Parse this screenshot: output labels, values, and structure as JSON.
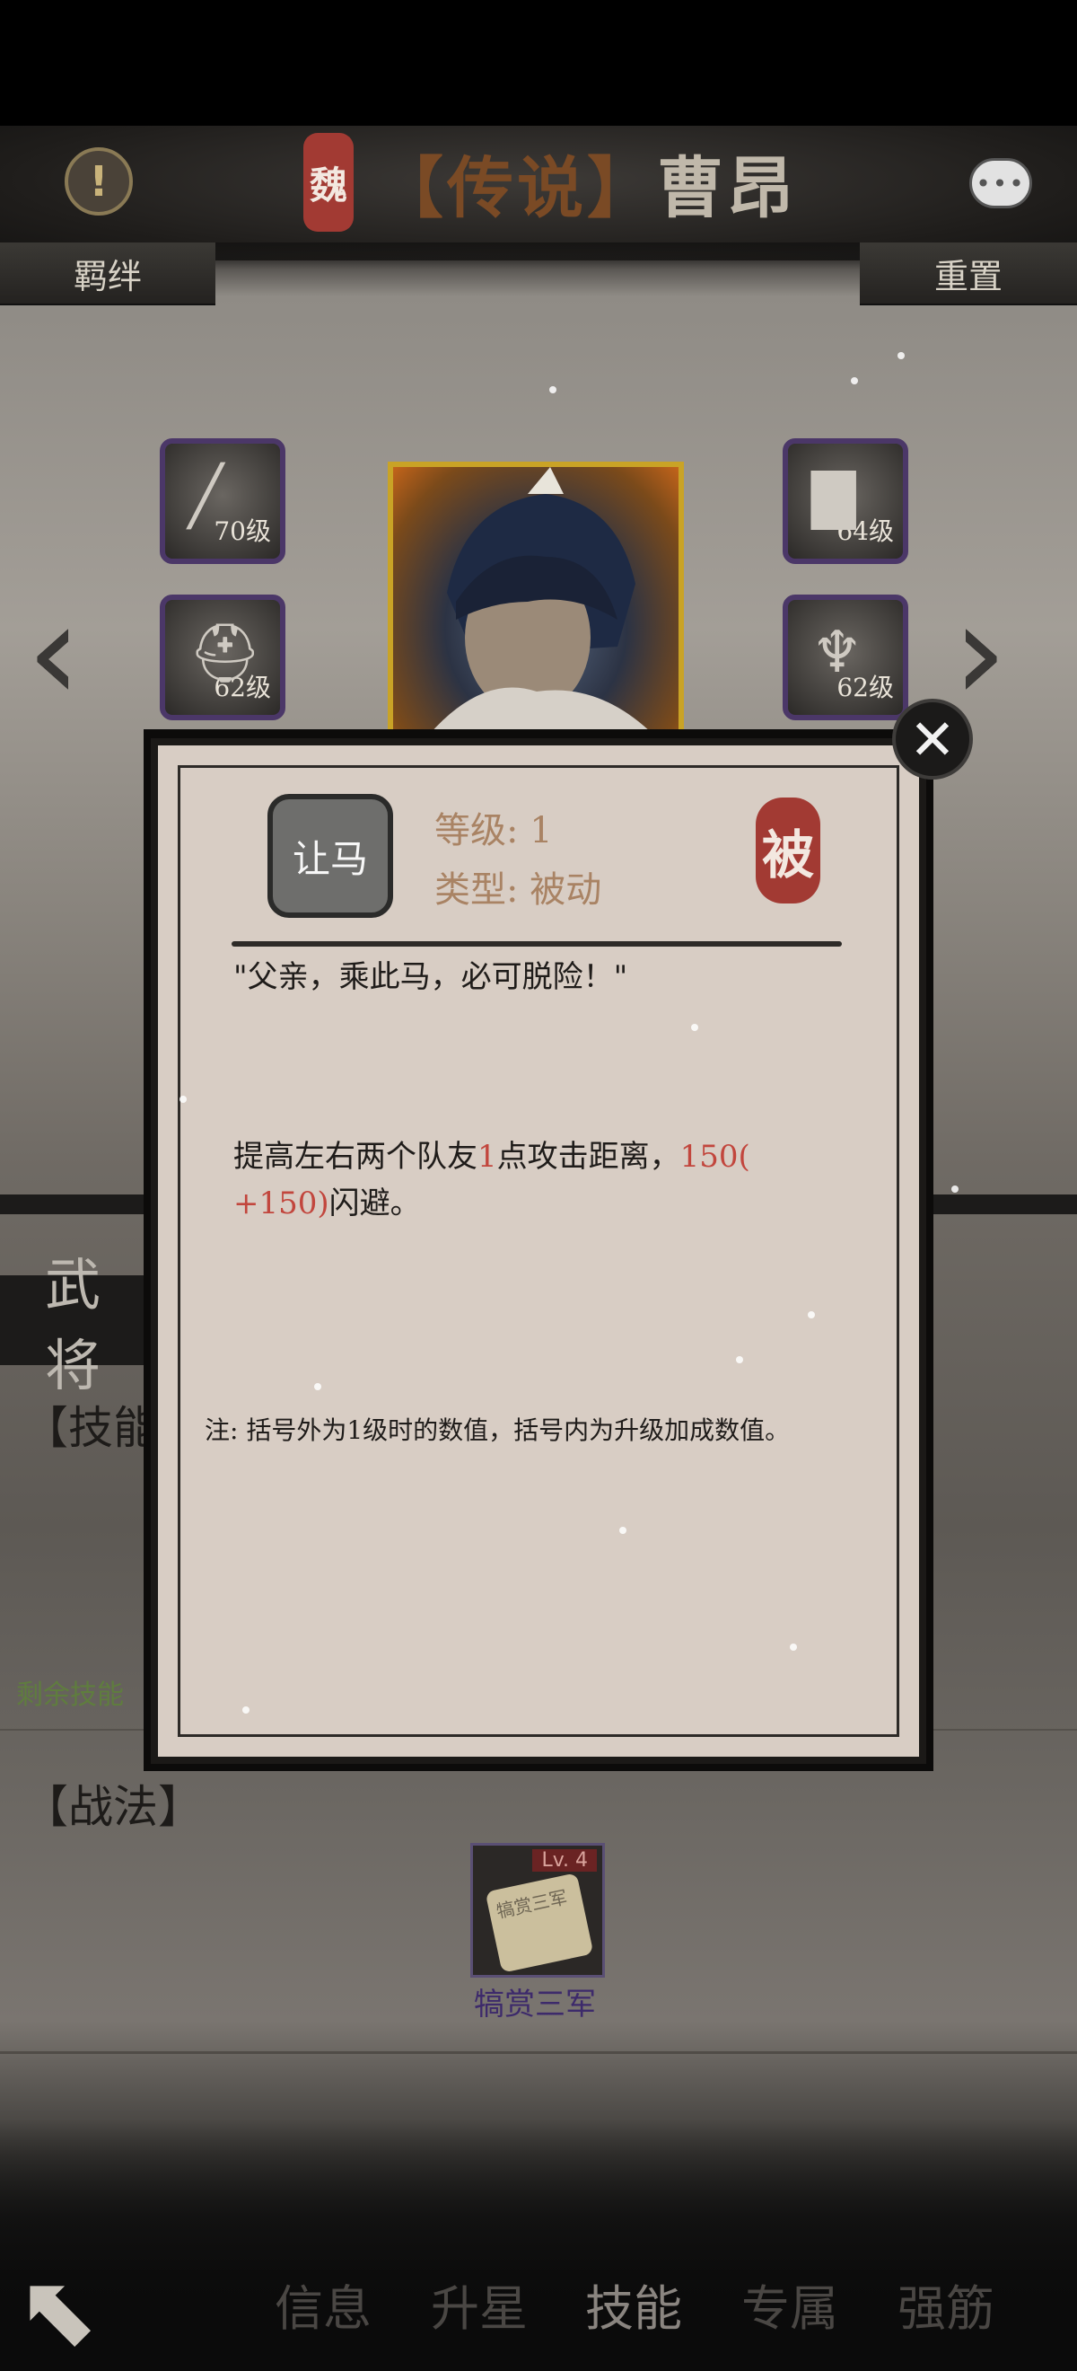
{
  "header": {
    "faction_seal": "魏",
    "title_rarity": "【传说】",
    "title_name": "曹昂",
    "alert_icon": "exclamation-icon",
    "chat_icon": "chat-bubble-icon",
    "left_tab": "羁绊",
    "right_tab": "重置"
  },
  "equipment": {
    "weapon_level": "70级",
    "armor_level": "64级",
    "helmet_level": "62级",
    "accessory_level": "62级"
  },
  "modal": {
    "skill_name": "让马",
    "level_text": "等级: 1",
    "type_text": "类型: 被动",
    "passive_seal": "被",
    "quote": "\"父亲，乘此马，必可脱险！\"",
    "desc_part1": "提高左右两个队友",
    "desc_num1": "1",
    "desc_part2": "点攻击距离，",
    "desc_num2": "150(",
    "desc_num3": "+150)",
    "desc_part3": "闪避。",
    "note": "注: 括号外为1级时的数值，括号内为升级加成数值。",
    "close_icon": "close-icon"
  },
  "page": {
    "wu_label": "武将",
    "skills_title": "【技能",
    "remaining_label": "剩余技能",
    "strategy_title": "【战法】",
    "strategy_level": "Lv. 4",
    "strategy_scroll_text": "犒赏三军",
    "strategy_name": "犒赏三军"
  },
  "bottom_nav": {
    "tabs": [
      "信息",
      "升星",
      "技能",
      "专属",
      "强筋"
    ],
    "active_tab": "技能",
    "back_icon": "back-arrow-icon"
  }
}
